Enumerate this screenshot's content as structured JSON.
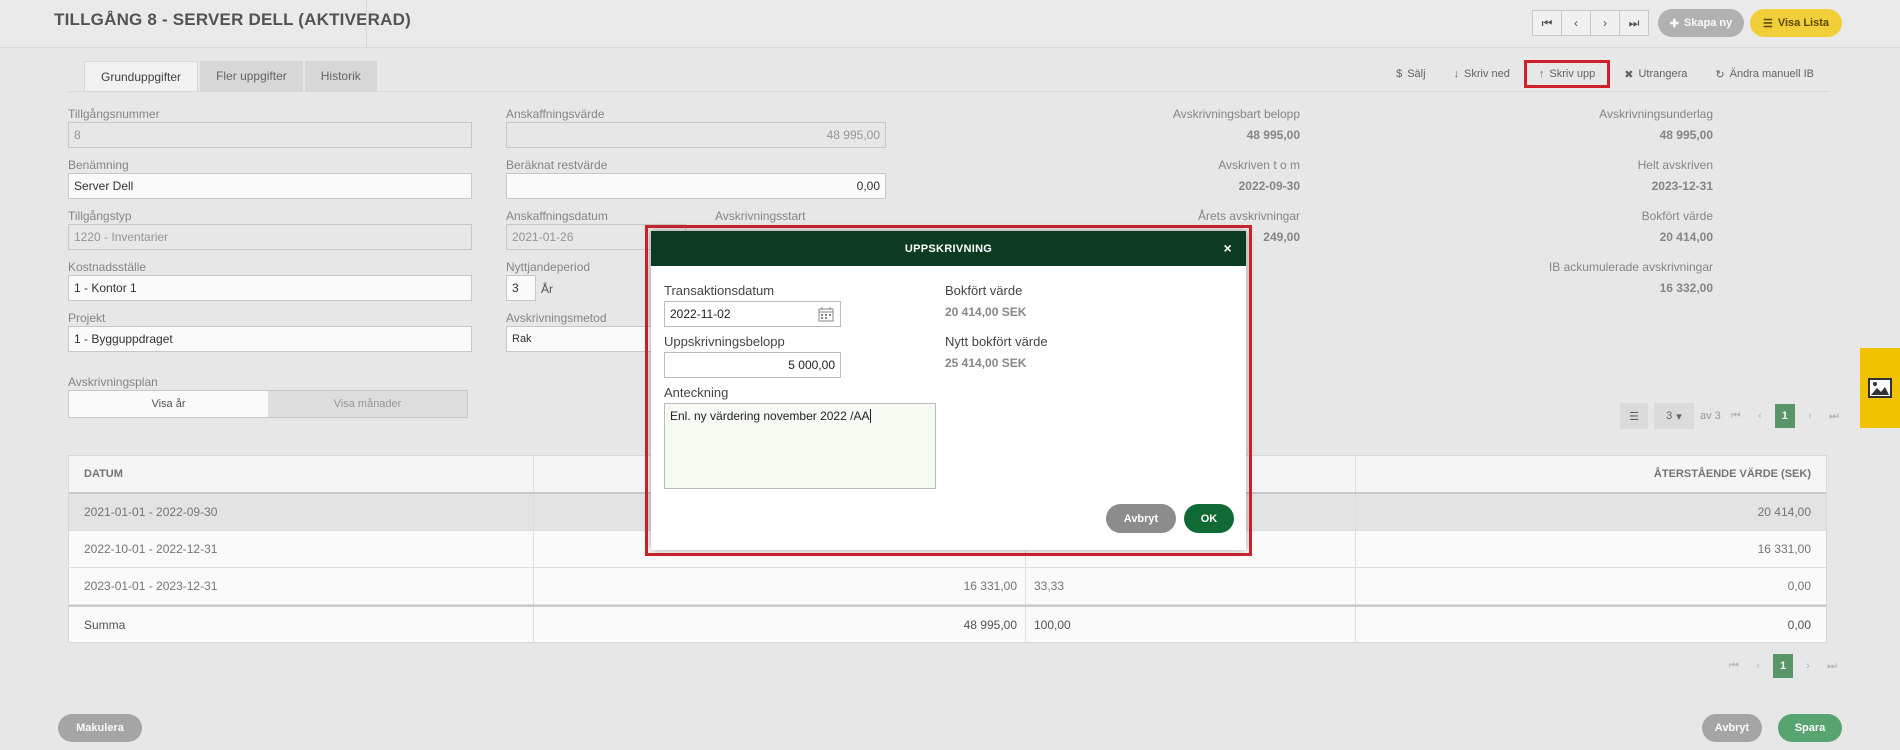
{
  "header": {
    "title": "TILLGÅNG 8 - SERVER DELL (AKTIVERAD)",
    "nav": [
      "⏮",
      "‹",
      "›",
      "⏭"
    ],
    "create_label": "Skapa ny",
    "list_label": "Visa Lista"
  },
  "tabs": [
    "Grunduppgifter",
    "Fler uppgifter",
    "Historik"
  ],
  "actions": [
    {
      "icon": "$",
      "label": "Sälj"
    },
    {
      "icon": "↓",
      "label": "Skriv ned"
    },
    {
      "icon": "↑",
      "label": "Skriv upp"
    },
    {
      "icon": "✖",
      "label": "Utrangera"
    },
    {
      "icon": "↻",
      "label": "Ändra manuell IB"
    }
  ],
  "form": {
    "asset_number": {
      "label": "Tillgångsnummer",
      "value": "8"
    },
    "name": {
      "label": "Benämning",
      "value": "Server Dell"
    },
    "asset_type": {
      "label": "Tillgångstyp",
      "value": "1220 - Inventarier"
    },
    "cost_center": {
      "label": "Kostnadsställe",
      "value": "1 - Kontor 1"
    },
    "project": {
      "label": "Projekt",
      "value": "1 - Bygguppdraget"
    },
    "acquisition_value": {
      "label": "Anskaffningsvärde",
      "value": "48 995,00"
    },
    "residual_value": {
      "label": "Beräknat restvärde",
      "value": "0,00"
    },
    "acquisition_date": {
      "label": "Anskaffningsdatum",
      "value": "2021-01-26"
    },
    "depreciation_start": {
      "label": "Avskrivningsstart"
    },
    "useful_life": {
      "label": "Nyttjandeperiod",
      "value": "3",
      "unit": "År"
    },
    "depreciation_method": {
      "label": "Avskrivningsmetod",
      "value": "Rak"
    },
    "plan": {
      "label": "Avskrivningsplan",
      "years": "Visa år",
      "months": "Visa månader"
    }
  },
  "summary": {
    "depreciable_amount": {
      "label": "Avskrivningsbart belopp",
      "value": "48 995,00"
    },
    "depreciation_base": {
      "label": "Avskrivningsunderlag",
      "value": "48 995,00"
    },
    "depreciated_until": {
      "label": "Avskriven t o m",
      "value": "2022-09-30"
    },
    "fully_depreciated": {
      "label": "Helt avskriven",
      "value": "2023-12-31"
    },
    "year_depreciation": {
      "label": "Årets avskrivningar",
      "value": "249,00"
    },
    "book_value": {
      "label": "Bokfört värde",
      "value": "20 414,00"
    },
    "ib_accumulated": {
      "label": "IB ackumulerade avskrivningar",
      "value": "16 332,00"
    }
  },
  "pager_top": {
    "page_size": "3",
    "of": "av 3",
    "page": "1"
  },
  "pager_bottom": {
    "page": "1"
  },
  "table": {
    "headers": [
      "DATUM",
      "",
      "",
      "ÅTERSTÅENDE VÄRDE (SEK)"
    ],
    "rows": [
      [
        "2021-01-01 - 2022-09-30",
        "",
        "",
        "20 414,00"
      ],
      [
        "2022-10-01 - 2022-12-31",
        "",
        "",
        "16 331,00"
      ],
      [
        "2023-01-01 - 2023-12-31",
        "16 331,00",
        "33,33",
        "0,00"
      ]
    ],
    "sum": [
      "Summa",
      "48 995,00",
      "100,00",
      "0,00"
    ]
  },
  "bottom": {
    "void_label": "Makulera",
    "cancel_label": "Avbryt",
    "save_label": "Spara"
  },
  "modal": {
    "title": "UPPSKRIVNING",
    "close": "×",
    "transaction_date": {
      "label": "Transaktionsdatum",
      "value": "2022-11-02"
    },
    "amount": {
      "label": "Uppskrivningsbelopp",
      "value": "5 000,00"
    },
    "note": {
      "label": "Anteckning",
      "value": "Enl. ny värdering november 2022 /AA"
    },
    "book_value": {
      "label": "Bokfört värde",
      "value": "20 414,00 SEK"
    },
    "new_book_value": {
      "label": "Nytt bokfört värde",
      "value": "25 414,00 SEK"
    },
    "cancel_label": "Avbryt",
    "ok_label": "OK"
  },
  "colors": {
    "accent_green": "#0d3a23",
    "ok_green": "#0f6a33",
    "highlight_red": "#d0232a",
    "yellow": "#f7d43a"
  }
}
